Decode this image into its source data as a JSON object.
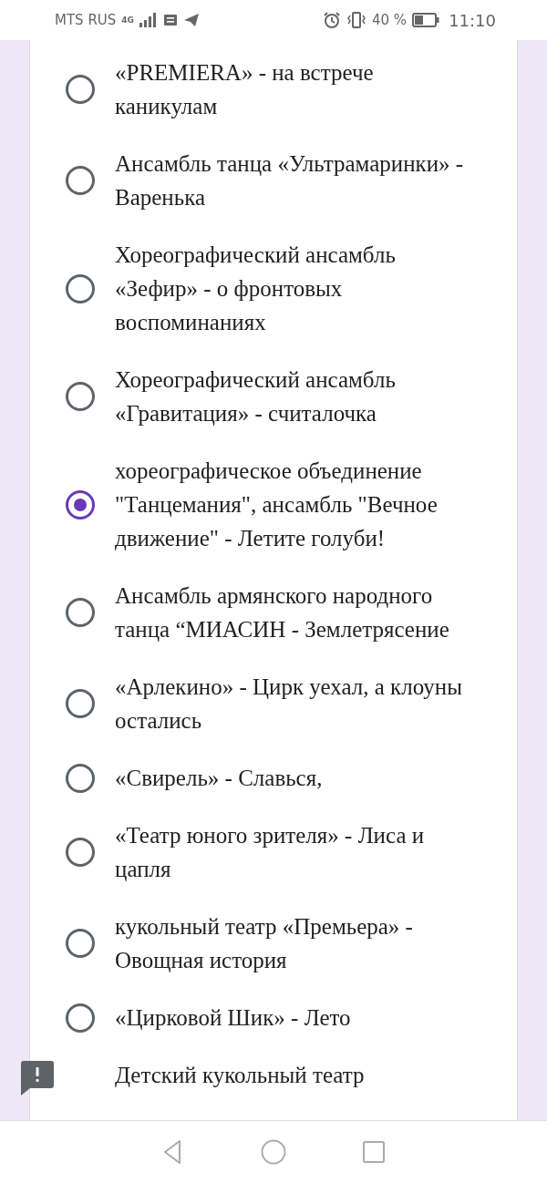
{
  "status_bar": {
    "carrier": "MTS RUS",
    "network": "4G",
    "battery": "40 %",
    "time": "11:10"
  },
  "options": [
    {
      "label": "«PREMIERA» - на встрече каникулам",
      "selected": false
    },
    {
      "label": "Ансамбль танца «Ультрамаринки» - Варенька",
      "selected": false
    },
    {
      "label": "Хореографический ансамбль «Зефир» - о фронтовых воспоминаниях",
      "selected": false
    },
    {
      "label": "Хореографический ансамбль «Гравитация» - считалочка",
      "selected": false
    },
    {
      "label": "хореографическое объединение \"Танцемания\", ансамбль \"Вечное движение\" - Летите голуби!",
      "selected": true
    },
    {
      "label": "Ансамбль армянского народного танца “МИАСИН - Землетрясение",
      "selected": false
    },
    {
      "label": "«Арлекино» - Цирк уехал, а клоуны остались",
      "selected": false
    },
    {
      "label": "«Свирель» - Славься,",
      "selected": false
    },
    {
      "label": "«Театр юного зрителя» - Лиса и цапля",
      "selected": false
    },
    {
      "label": "кукольный театр «Премьера» - Овощная история",
      "selected": false
    },
    {
      "label": "«Цирковой Шик» - Лето",
      "selected": false
    }
  ],
  "partial_option": {
    "label": "Детский кукольный театр"
  }
}
